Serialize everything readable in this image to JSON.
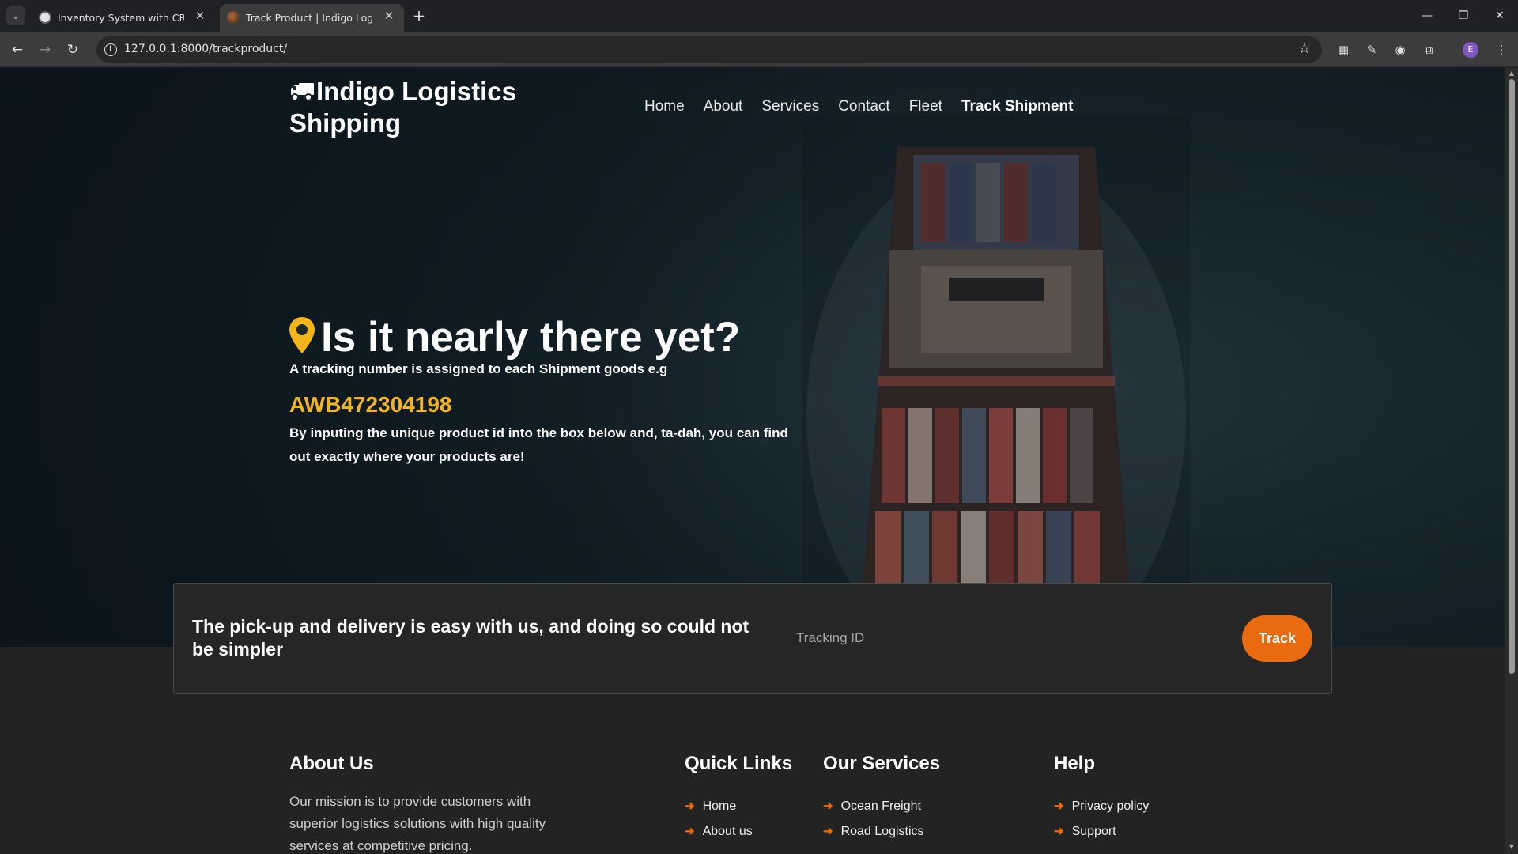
{
  "browser": {
    "tabs": [
      {
        "title": "Inventory System with CRUD"
      },
      {
        "title": "Track Product | Indigo Logistics"
      }
    ],
    "url": "127.0.0.1:8000/trackproduct/",
    "profile_initial": "E"
  },
  "site": {
    "brand": "Indigo Logistics Shipping",
    "nav": [
      {
        "label": "Home"
      },
      {
        "label": "About"
      },
      {
        "label": "Services"
      },
      {
        "label": "Contact"
      },
      {
        "label": "Fleet"
      },
      {
        "label": "Track Shipment",
        "active": true
      }
    ]
  },
  "hero": {
    "headline": "Is it nearly there yet?",
    "intro": "A tracking number is assigned to each Shipment goods e.g",
    "example_id": "AWB472304198",
    "instructions": "By inputing the unique product id into the box below and, ta-dah, you can find out exactly where your products are!"
  },
  "tracker": {
    "message": "The pick-up and delivery is easy with us, and doing so could not be simpler",
    "placeholder": "Tracking ID",
    "button_label": "Track"
  },
  "footer": {
    "about_title": "About Us",
    "about_text": "Our mission is to provide customers with superior logistics solutions with high quality services at competitive pricing.",
    "quick_links_title": "Quick Links",
    "quick_links": [
      {
        "label": "Home"
      },
      {
        "label": "About us"
      }
    ],
    "services_title": "Our Services",
    "services": [
      {
        "label": "Ocean Freight"
      },
      {
        "label": "Road Logistics"
      }
    ],
    "help_title": "Help",
    "help": [
      {
        "label": "Privacy policy"
      },
      {
        "label": "Support"
      }
    ]
  },
  "colors": {
    "accent_orange": "#ea6a0f",
    "highlight_yellow": "#f4b51a",
    "chrome_dark": "#202124",
    "page_dark": "#232323"
  }
}
